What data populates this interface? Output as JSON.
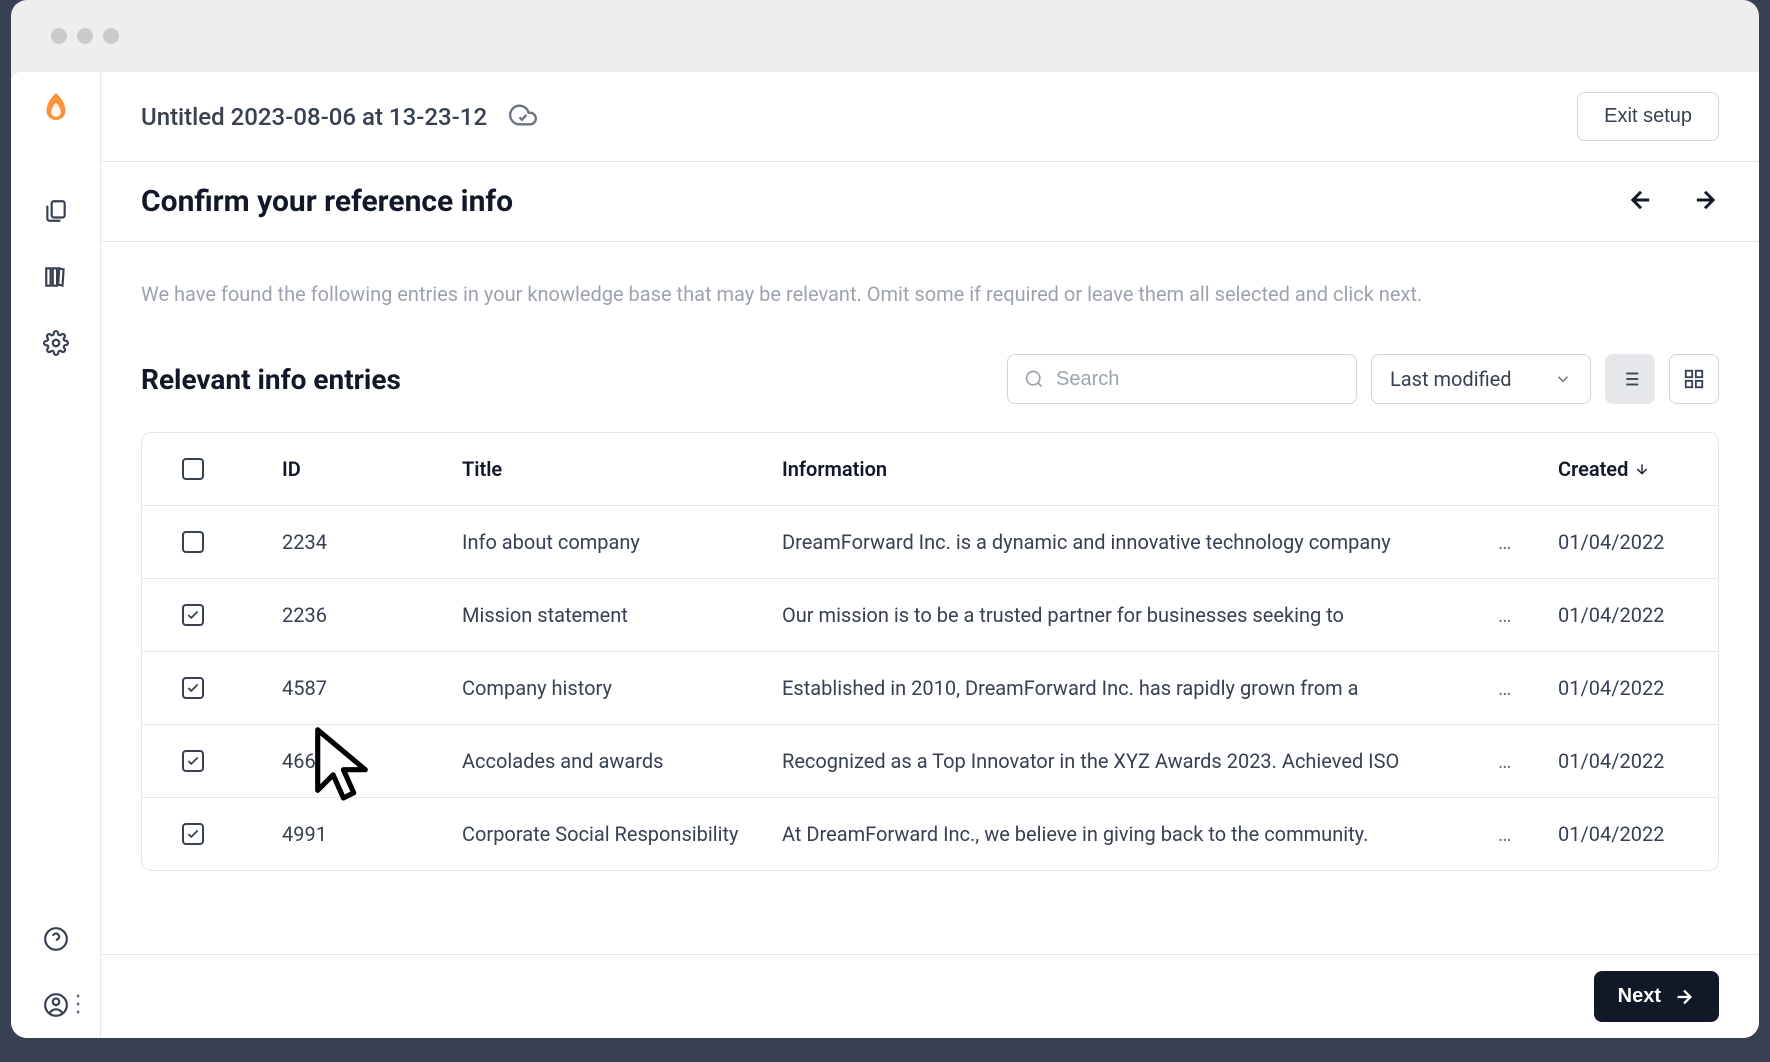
{
  "topbar": {
    "doc_title": "Untitled 2023-08-06 at 13-23-12",
    "exit_label": "Exit setup"
  },
  "section": {
    "title": "Confirm your reference info",
    "description": "We have found the following entries in your knowledge base that may be relevant. Omit some if required or leave them all selected and click next."
  },
  "list": {
    "title": "Relevant info entries",
    "search_placeholder": "Search",
    "sort_label": "Last modified"
  },
  "table": {
    "headers": {
      "id": "ID",
      "title": "Title",
      "information": "Information",
      "created": "Created"
    },
    "rows": [
      {
        "checked": false,
        "id": "2234",
        "title": "Info about company",
        "info": "DreamForward Inc. is a dynamic and innovative technology company",
        "created": "01/04/2022"
      },
      {
        "checked": true,
        "id": "2236",
        "title": "Mission statement",
        "info": "Our mission is to be a trusted partner for businesses seeking to",
        "created": "01/04/2022"
      },
      {
        "checked": true,
        "id": "4587",
        "title": "Company history",
        "info": "Established in 2010, DreamForward Inc. has rapidly grown from a",
        "created": "01/04/2022"
      },
      {
        "checked": true,
        "id": "4668",
        "title": "Accolades and awards",
        "info": "Recognized as a Top Innovator in the XYZ Awards 2023. Achieved ISO",
        "created": "01/04/2022"
      },
      {
        "checked": true,
        "id": "4991",
        "title": "Corporate Social Responsibility",
        "info": "At DreamForward Inc., we believe in giving back to the community.",
        "created": "01/04/2022"
      }
    ]
  },
  "footer": {
    "next_label": "Next"
  }
}
